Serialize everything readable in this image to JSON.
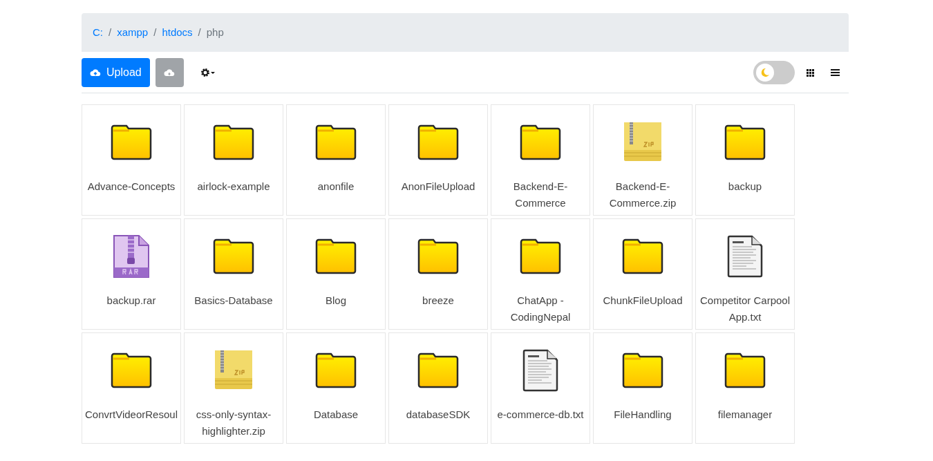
{
  "breadcrumb": [
    {
      "label": "C:",
      "link": true
    },
    {
      "separator": "/",
      "label": "xampp",
      "link": true
    },
    {
      "separator": "/",
      "label": "htdocs",
      "link": true
    },
    {
      "separator": "/",
      "label": "php",
      "link": false
    }
  ],
  "toolbar": {
    "upload_label": "Upload",
    "dark_mode": {
      "on": false
    }
  },
  "items": [
    {
      "name": "Advance-Concepts",
      "kind": "folder"
    },
    {
      "name": "airlock-example",
      "kind": "folder"
    },
    {
      "name": "anonfile",
      "kind": "folder"
    },
    {
      "name": "AnonFileUpload",
      "kind": "folder"
    },
    {
      "name": "Backend-E-Commerce",
      "kind": "folder"
    },
    {
      "name": "Backend-E-Commerce.zip",
      "kind": "zip"
    },
    {
      "name": "backup",
      "kind": "folder"
    },
    {
      "name": "backup.rar",
      "kind": "rar"
    },
    {
      "name": "Basics-Database",
      "kind": "folder"
    },
    {
      "name": "Blog",
      "kind": "folder"
    },
    {
      "name": "breeze",
      "kind": "folder"
    },
    {
      "name": "ChatApp - CodingNepal",
      "kind": "folder"
    },
    {
      "name": "ChunkFileUpload",
      "kind": "folder"
    },
    {
      "name": "Competitor Carpool App.txt",
      "kind": "txt"
    },
    {
      "name": "ConvrtVideorResoul",
      "kind": "folder"
    },
    {
      "name": "css-only-syntax-highlighter.zip",
      "kind": "zip"
    },
    {
      "name": "Database",
      "kind": "folder"
    },
    {
      "name": "databaseSDK",
      "kind": "folder"
    },
    {
      "name": "e-commerce-db.txt",
      "kind": "txt"
    },
    {
      "name": "FileHandling",
      "kind": "folder"
    },
    {
      "name": "filemanager",
      "kind": "folder"
    }
  ]
}
